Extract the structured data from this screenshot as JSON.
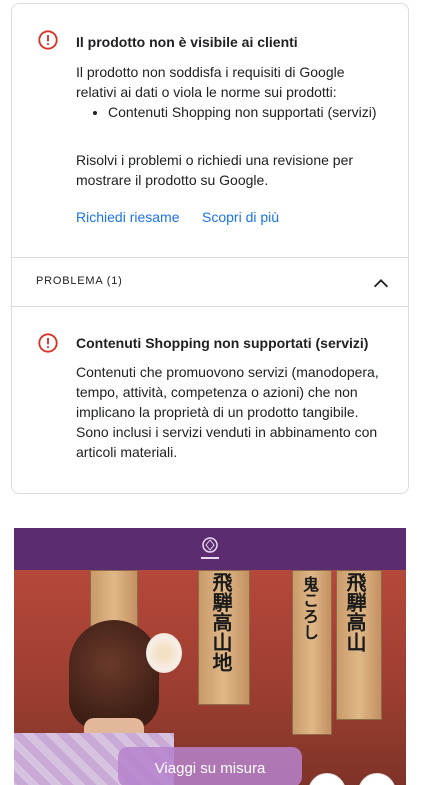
{
  "status_card": {
    "title": "Il prodotto non è visibile ai clienti",
    "description": "Il prodotto non soddisfa i requisiti di Google relativi ai dati o viola le norme sui prodotti:",
    "bullets": [
      "Contenuti Shopping non supportati (servizi)"
    ],
    "resolution": "Risolvi i problemi o richiedi una revisione per mostrare il prodotto su Google.",
    "request_review_label": "Richiedi riesame",
    "learn_more_label": "Scopri di più"
  },
  "issues_section": {
    "label": "PROBLEMA (1)",
    "issue_title": "Contenuti Shopping non supportati (servizi)",
    "issue_description": "Contenuti che promuovono servizi (manodopera, tempo, attività, competenza o azioni) che non implicano la proprietà di un prodotto tangibile. Sono inclusi i servizi venduti in abbinamento con articoli materiali."
  },
  "product_image": {
    "cta_label": "Viaggi su misura"
  },
  "colors": {
    "error_red": "#d93025",
    "link_blue": "#1a73e8",
    "brand_purple": "#5b2c6f"
  },
  "icons": [
    "error-circle-icon",
    "chevron-up-icon"
  ]
}
